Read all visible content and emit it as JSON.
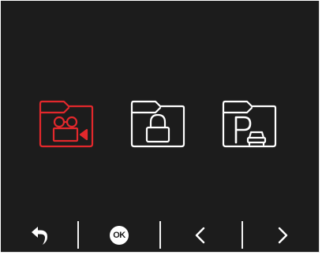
{
  "folders": [
    {
      "id": "video",
      "icon": "video-folder-icon",
      "state": "selected",
      "color": "#e2282c"
    },
    {
      "id": "locked",
      "icon": "lock-folder-icon",
      "state": "normal",
      "color": "#ffffff"
    },
    {
      "id": "parking",
      "icon": "parking-folder-icon",
      "state": "normal",
      "color": "#ffffff"
    }
  ],
  "toolbar": {
    "ok_label": "OK",
    "icons": [
      "back-arrow-icon",
      "ok-icon",
      "chevron-left-icon",
      "chevron-right-icon"
    ]
  },
  "colors": {
    "background": "#1c1c1c",
    "accent": "#e2282c",
    "foreground": "#ffffff"
  }
}
